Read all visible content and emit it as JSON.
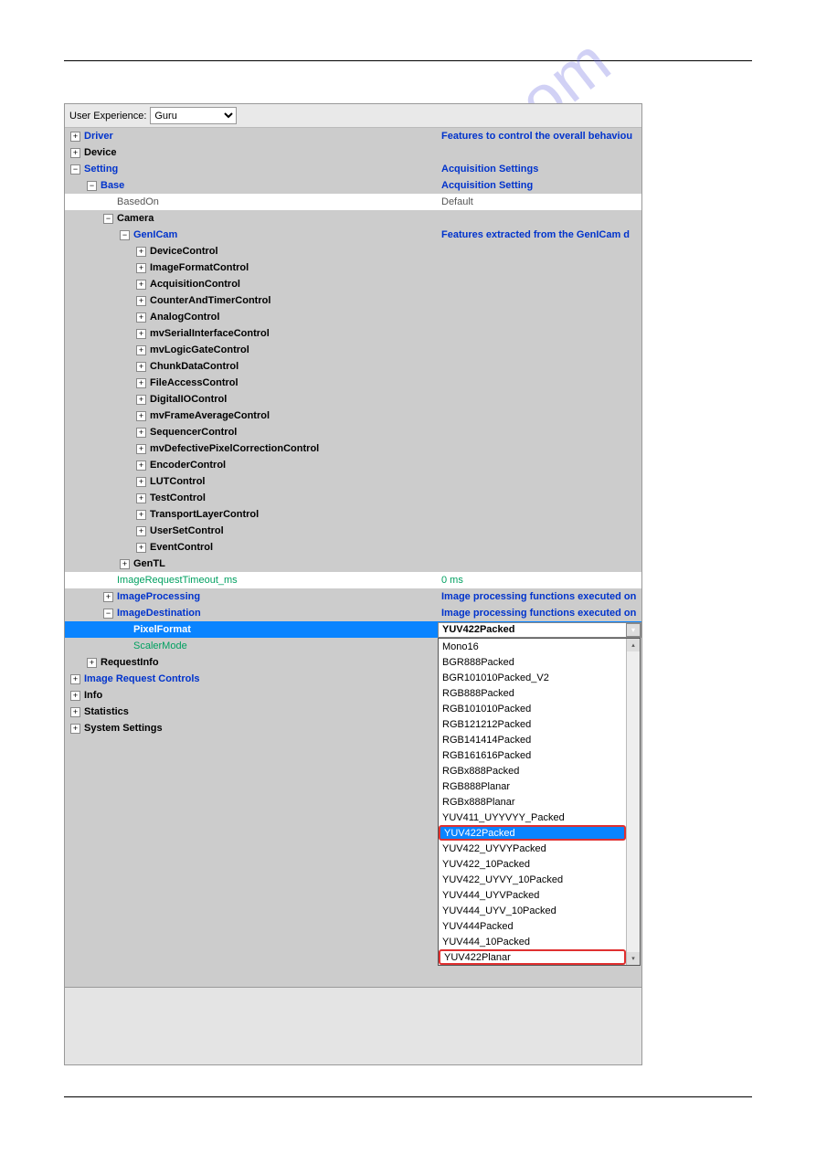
{
  "toolbar": {
    "label": "User Experience:",
    "value": "Guru"
  },
  "tree": [
    {
      "lvl": 0,
      "exp": "+",
      "txt": "Driver",
      "cls": "bold blue",
      "val": "Features to control the overall behaviou",
      "vcls": "bold blue"
    },
    {
      "lvl": 0,
      "exp": "+",
      "txt": "Device",
      "cls": "bold black"
    },
    {
      "lvl": 0,
      "exp": "-",
      "txt": "Setting",
      "cls": "bold blue",
      "val": "Acquisition Settings",
      "vcls": "bold blue"
    },
    {
      "lvl": 1,
      "exp": "-",
      "txt": "Base",
      "cls": "bold blue",
      "val": "Acquisition Setting",
      "vcls": "bold blue"
    },
    {
      "lvl": 2,
      "exp": "",
      "txt": "BasedOn",
      "cls": "gray",
      "val": "Default",
      "vcls": "gray",
      "white": true
    },
    {
      "lvl": 2,
      "exp": "-",
      "txt": "Camera",
      "cls": "bold black"
    },
    {
      "lvl": 3,
      "exp": "-",
      "txt": "GenICam",
      "cls": "bold blue",
      "val": "Features extracted from the GenICam d",
      "vcls": "bold blue"
    },
    {
      "lvl": 4,
      "exp": "+",
      "txt": "DeviceControl",
      "cls": "bold black"
    },
    {
      "lvl": 4,
      "exp": "+",
      "txt": "ImageFormatControl",
      "cls": "bold black"
    },
    {
      "lvl": 4,
      "exp": "+",
      "txt": "AcquisitionControl",
      "cls": "bold black"
    },
    {
      "lvl": 4,
      "exp": "+",
      "txt": "CounterAndTimerControl",
      "cls": "bold black"
    },
    {
      "lvl": 4,
      "exp": "+",
      "txt": "AnalogControl",
      "cls": "bold black"
    },
    {
      "lvl": 4,
      "exp": "+",
      "txt": "mvSerialInterfaceControl",
      "cls": "bold black"
    },
    {
      "lvl": 4,
      "exp": "+",
      "txt": "mvLogicGateControl",
      "cls": "bold black"
    },
    {
      "lvl": 4,
      "exp": "+",
      "txt": "ChunkDataControl",
      "cls": "bold black"
    },
    {
      "lvl": 4,
      "exp": "+",
      "txt": "FileAccessControl",
      "cls": "bold black"
    },
    {
      "lvl": 4,
      "exp": "+",
      "txt": "DigitalIOControl",
      "cls": "bold black"
    },
    {
      "lvl": 4,
      "exp": "+",
      "txt": "mvFrameAverageControl",
      "cls": "bold black"
    },
    {
      "lvl": 4,
      "exp": "+",
      "txt": "SequencerControl",
      "cls": "bold black"
    },
    {
      "lvl": 4,
      "exp": "+",
      "txt": "mvDefectivePixelCorrectionControl",
      "cls": "bold black"
    },
    {
      "lvl": 4,
      "exp": "+",
      "txt": "EncoderControl",
      "cls": "bold black"
    },
    {
      "lvl": 4,
      "exp": "+",
      "txt": "LUTControl",
      "cls": "bold black"
    },
    {
      "lvl": 4,
      "exp": "+",
      "txt": "TestControl",
      "cls": "bold black"
    },
    {
      "lvl": 4,
      "exp": "+",
      "txt": "TransportLayerControl",
      "cls": "bold black"
    },
    {
      "lvl": 4,
      "exp": "+",
      "txt": "UserSetControl",
      "cls": "bold black"
    },
    {
      "lvl": 4,
      "exp": "+",
      "txt": "EventControl",
      "cls": "bold black"
    },
    {
      "lvl": 3,
      "exp": "+",
      "txt": "GenTL",
      "cls": "bold black"
    },
    {
      "lvl": 2,
      "exp": "",
      "txt": "ImageRequestTimeout_ms",
      "cls": "green",
      "val": "0 ms",
      "vcls": "green",
      "white": true
    },
    {
      "lvl": 2,
      "exp": "+",
      "txt": "ImageProcessing",
      "cls": "bold blue",
      "val": "Image processing functions executed on",
      "vcls": "bold blue"
    },
    {
      "lvl": 2,
      "exp": "-",
      "txt": "ImageDestination",
      "cls": "bold blue",
      "val": "Image processing functions executed on",
      "vcls": "bold blue"
    },
    {
      "lvl": 3,
      "exp": "",
      "txt": "PixelFormat",
      "cls": "bold",
      "val": "YUV422Packed",
      "vcls": "bold black",
      "sel": true,
      "dd": true
    },
    {
      "lvl": 3,
      "exp": "",
      "txt": "ScalerMode",
      "cls": "green"
    },
    {
      "lvl": 1,
      "exp": "+",
      "txt": "RequestInfo",
      "cls": "bold black"
    },
    {
      "lvl": 0,
      "exp": "+",
      "txt": "Image Request Controls",
      "cls": "bold blue"
    },
    {
      "lvl": 0,
      "exp": "+",
      "txt": "Info",
      "cls": "bold black"
    },
    {
      "lvl": 0,
      "exp": "+",
      "txt": "Statistics",
      "cls": "bold black"
    },
    {
      "lvl": 0,
      "exp": "+",
      "txt": "System Settings",
      "cls": "bold black"
    }
  ],
  "dropdown": {
    "top_row_index": 30,
    "items": [
      {
        "txt": "Mono16"
      },
      {
        "txt": "BGR888Packed"
      },
      {
        "txt": "BGR101010Packed_V2"
      },
      {
        "txt": "RGB888Packed"
      },
      {
        "txt": "RGB101010Packed"
      },
      {
        "txt": "RGB121212Packed"
      },
      {
        "txt": "RGB141414Packed"
      },
      {
        "txt": "RGB161616Packed"
      },
      {
        "txt": "RGBx888Packed"
      },
      {
        "txt": "RGB888Planar"
      },
      {
        "txt": "RGBx888Planar"
      },
      {
        "txt": "YUV411_UYYVYY_Packed"
      },
      {
        "txt": "YUV422Packed",
        "sel": true,
        "ring": true
      },
      {
        "txt": "YUV422_UYVYPacked"
      },
      {
        "txt": "YUV422_10Packed"
      },
      {
        "txt": "YUV422_UYVY_10Packed"
      },
      {
        "txt": "YUV444_UYVPacked"
      },
      {
        "txt": "YUV444_UYV_10Packed"
      },
      {
        "txt": "YUV444Packed"
      },
      {
        "txt": "YUV444_10Packed"
      },
      {
        "txt": "YUV422Planar",
        "ring": true
      }
    ]
  },
  "watermark": "manualshive.com"
}
